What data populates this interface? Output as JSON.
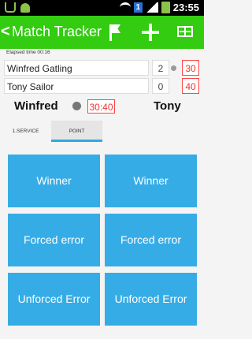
{
  "status_bar": {
    "time": "23:55",
    "notification_badge": "1",
    "icons": [
      "usb-icon",
      "android-icon",
      "wifi-icon",
      "signal-icon",
      "battery-icon"
    ]
  },
  "action_bar": {
    "back_label": "<",
    "title": "Match Tracker",
    "actions": [
      "flag-icon",
      "plus-icon",
      "court-icon"
    ],
    "color": "#33cc11"
  },
  "match": {
    "elapsed": "Elapsed time 00:16",
    "players": [
      {
        "name": "Winfred Gatling",
        "games": "2",
        "score": "30"
      },
      {
        "name": "Tony Sailor",
        "games": "0",
        "score": "40"
      }
    ],
    "short_name_1": "Winfred",
    "short_name_2": "Tony",
    "point_score": "30:40"
  },
  "tabs": [
    {
      "label": "1.SERVICE"
    },
    {
      "label": "POINT"
    }
  ],
  "buttons": {
    "winner_left": "Winner",
    "winner_right": "Winner",
    "forced_left": "Forced error",
    "forced_right": "Forced error",
    "unforced_left": "Unforced Error",
    "unforced_right": "Unforced Error",
    "color": "#36ace6"
  }
}
